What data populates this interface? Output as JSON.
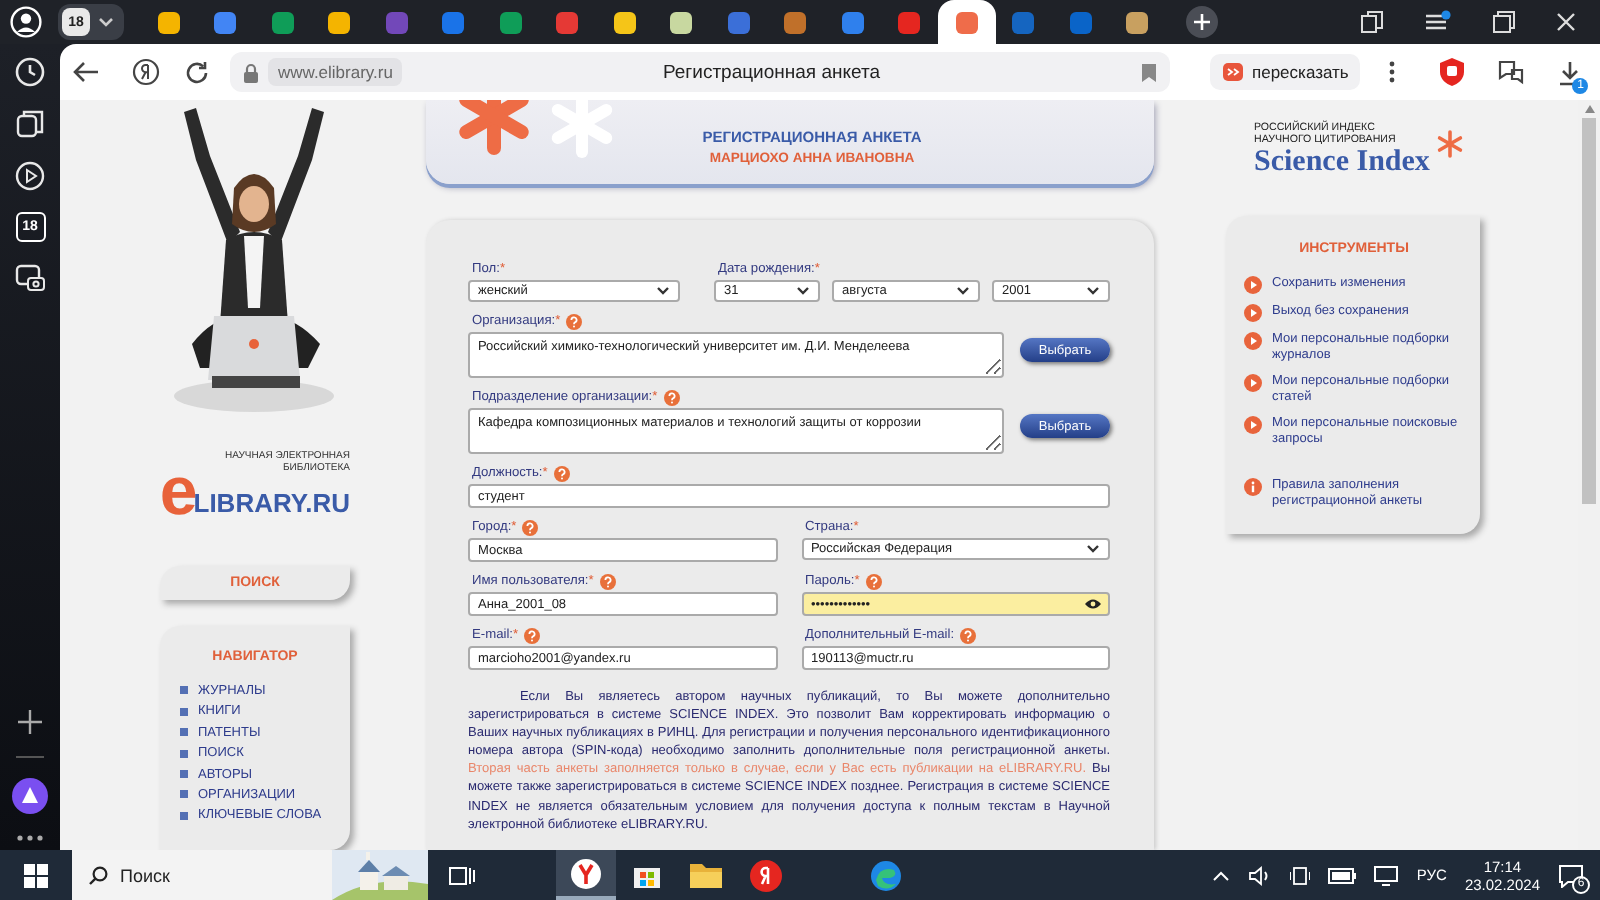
{
  "browser": {
    "tab_count": "18",
    "tabs": [
      {
        "color": "#f4b400",
        "selected": false
      },
      {
        "color": "#4285f4",
        "selected": false
      },
      {
        "color": "#0f9d58",
        "selected": false
      },
      {
        "color": "#f4b400",
        "selected": false
      },
      {
        "color": "#7248b9",
        "selected": false
      },
      {
        "color": "#1a73e8",
        "selected": false
      },
      {
        "color": "#0f9d58",
        "selected": false
      },
      {
        "color": "#e53935",
        "selected": false
      },
      {
        "color": "#f5c518",
        "selected": false
      },
      {
        "color": "#c8d8a0",
        "selected": false
      },
      {
        "color": "#3b6fd8",
        "selected": false
      },
      {
        "color": "#c0702a",
        "selected": false
      },
      {
        "color": "#2f80ed",
        "selected": false
      },
      {
        "color": "#e52620",
        "selected": false
      },
      {
        "color": "#ef6c4a",
        "selected": true
      },
      {
        "color": "#1565c0",
        "selected": false
      },
      {
        "color": "#0a64c8",
        "selected": false
      },
      {
        "color": "#c8a060",
        "selected": false
      }
    ]
  },
  "browser_sidebar": {
    "tab_count": "18"
  },
  "address_bar": {
    "url": "www.elibrary.ru",
    "page_title": "Регистрационная анкета",
    "retell_button": "пересказать",
    "downloads_badge": "1"
  },
  "left_column": {
    "logo": {
      "tagline": [
        "НАУЧНАЯ ЭЛЕКТРОННАЯ",
        "БИБЛИОТЕКА"
      ],
      "letter": "e",
      "name": "LIBRARY.RU"
    },
    "search_box": "ПОИСК",
    "navigator": {
      "title": "НАВИГАТОР",
      "items": [
        "ЖУРНАЛЫ",
        "КНИГИ",
        "ПАТЕНТЫ",
        "ПОИСК",
        "АВТОРЫ",
        "ОРГАНИЗАЦИИ",
        "КЛЮЧЕВЫЕ СЛОВА"
      ]
    }
  },
  "header": {
    "title": "РЕГИСТРАЦИОННАЯ АНКЕТА",
    "subtitle": "МАРЦИОХО АННА ИВАНОВНА"
  },
  "form": {
    "rows": [
      [
        {
          "kind": "select",
          "label": "Пол:",
          "required_mark": "*",
          "help": false,
          "value": "женский"
        },
        {
          "kind": "date",
          "label": "Дата рождения:",
          "required_mark": "*",
          "help": false,
          "values": [
            "31",
            "августа",
            "2001"
          ]
        }
      ],
      [
        {
          "kind": "textarea",
          "label": "Организация:",
          "required_mark": "*",
          "help": true,
          "value": "Российский химико-технологический университет им. Д.И. Менделеева",
          "button": "Выбрать"
        }
      ],
      [
        {
          "kind": "textarea",
          "label": "Подразделение организации:",
          "required_mark": "*",
          "help": true,
          "value": "Кафедра композиционных материалов и технологий защиты от коррозии",
          "button": "Выбрать"
        }
      ],
      [
        {
          "kind": "input",
          "label": "Должность:",
          "required_mark": "*",
          "help": true,
          "value": "студент",
          "autofilled": false
        }
      ],
      [
        {
          "kind": "input",
          "label": "Город:",
          "required_mark": "*",
          "help": true,
          "value": "Москва",
          "autofilled": false
        },
        {
          "kind": "select",
          "label": "Страна:",
          "required_mark": "*",
          "help": false,
          "value": "Российская Федерация"
        }
      ],
      [
        {
          "kind": "input",
          "label": "Имя пользователя:",
          "required_mark": "*",
          "help": true,
          "value": "Анна_2001_08",
          "autofilled": false
        },
        {
          "kind": "password",
          "label": "Пароль:",
          "required_mark": "*",
          "help": true,
          "value": "•••••••••••••",
          "autofilled": true
        }
      ],
      [
        {
          "kind": "input",
          "label": "E-mail:",
          "required_mark": "*",
          "help": true,
          "value": "marcioho2001@yandex.ru",
          "autofilled": false
        },
        {
          "kind": "input",
          "label": "Дополнительный E-mail:",
          "help": true,
          "value": "190113@muctr.ru",
          "autofilled": false
        }
      ]
    ],
    "note": [
      {
        "kind": "normal",
        "text": "Если Вы являетесь автором научных публикаций, то Вы можете дополнительно зарегистрироваться в системе SCIENCE INDEX. Это позволит Вам корректировать информацию о Ваших научных публикациях в РИНЦ. Для регистрации и получения персонального идентификационного номера автора (SPIN-кода) необходимо заполнить дополнительные поля регистрационной анкеты. "
      },
      {
        "kind": "highlight",
        "text": "Вторая часть анкеты заполняется только в случае, если у Вас есть публикации на eLIBRARY.RU."
      },
      {
        "kind": "normal",
        "text": " Вы можете также зарегистрироваться в системе SCIENCE INDEX позднее. Регистрация в системе SCIENCE INDEX не является обязательным условием для получения доступа к полным текстам в Научной электронной библиотеке eLIBRARY.RU."
      }
    ]
  },
  "science_index": {
    "caption": [
      "РОССИЙСКИЙ ИНДЕКС",
      "НАУЧНОГО ЦИТИРОВАНИЯ"
    ],
    "name": "Science Index"
  },
  "tools": {
    "title": "ИНСТРУМЕНТЫ",
    "items": [
      {
        "kind": "action",
        "label": "Сохранить изменения"
      },
      {
        "kind": "action",
        "label": "Выход без сохранения"
      },
      {
        "kind": "action",
        "label": "Мои персональные подборки журналов"
      },
      {
        "kind": "action",
        "label": "Мои персональные подборки статей"
      },
      {
        "kind": "action",
        "label": "Мои персональные поисковые запросы"
      },
      {
        "kind": "info",
        "label": "Правила заполнения регистрационной анкеты"
      }
    ]
  },
  "taskbar": {
    "search_placeholder": "Поиск",
    "apps": [
      {
        "kind": "yandex-browser",
        "selected": true
      },
      {
        "kind": "store",
        "selected": false
      },
      {
        "kind": "explorer",
        "selected": false
      },
      {
        "kind": "yandex",
        "selected": false
      },
      {
        "kind": "edge",
        "selected": false
      }
    ],
    "language": "РУС",
    "time": "17:14",
    "date": "23.02.2024",
    "notifications": "6"
  }
}
